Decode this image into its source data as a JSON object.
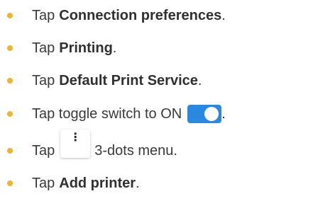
{
  "steps": [
    {
      "prefix": "Tap",
      "bold": "Connection preferences",
      "suffix": "."
    },
    {
      "prefix": "Tap",
      "bold": "Printing",
      "suffix": "."
    },
    {
      "prefix": "Tap",
      "bold": "Default Print Service",
      "suffix": "."
    },
    {
      "prefix": "Tap toggle switch to ON",
      "suffix": "."
    },
    {
      "prefix": "Tap",
      "suffix": "3-dots menu.",
      "menu_glyph": "⋮"
    },
    {
      "prefix": "Tap",
      "bold": "Add printer",
      "suffix": "."
    }
  ],
  "colors": {
    "bullet": "#f2b233",
    "toggle_on": "#2b88e0"
  },
  "icons": [
    "toggle-switch-on-icon",
    "three-dots-menu-icon"
  ]
}
